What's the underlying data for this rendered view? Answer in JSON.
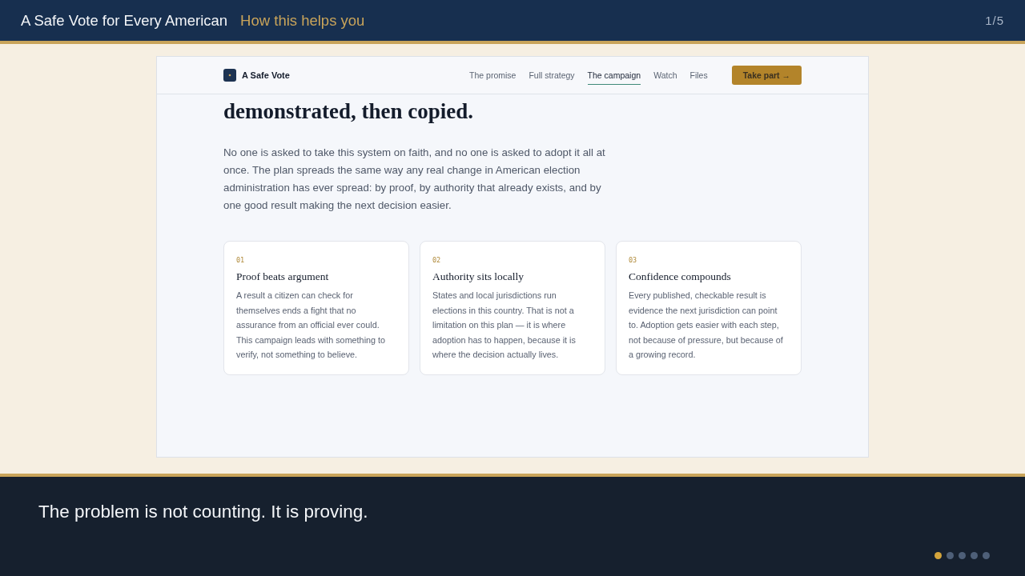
{
  "header": {
    "title": "A Safe Vote for Every American",
    "subtitle": "How this helps you",
    "counter": "1/5"
  },
  "embedded_page": {
    "nav": {
      "brand": "A Safe Vote",
      "links": [
        {
          "label": "The promise",
          "selected": false
        },
        {
          "label": "Full strategy",
          "selected": false
        },
        {
          "label": "The campaign",
          "selected": true
        },
        {
          "label": "Watch",
          "selected": false
        },
        {
          "label": "Files",
          "selected": false
        }
      ],
      "cta": "Take part →"
    },
    "headline": "demonstrated, then copied.",
    "intro": "No one is asked to take this system on faith, and no one is asked to adopt it all at once. The plan spreads the same way any real change in American election administration has ever spread: by proof, by authority that already exists, and by one good result making the next decision easier.",
    "cards": [
      {
        "number": "01",
        "title": "Proof beats argument",
        "body": "A result a citizen can check for themselves ends a fight that no assurance from an official ever could. This campaign leads with something to verify, not something to believe."
      },
      {
        "number": "02",
        "title": "Authority sits locally",
        "body": "States and local jurisdictions run elections in this country. That is not a limitation on this plan — it is where adoption has to happen, because it is where the decision actually lives."
      },
      {
        "number": "03",
        "title": "Confidence compounds",
        "body": "Every published, checkable result is evidence the next jurisdiction can point to. Adoption gets easier with each step, not because of pressure, but because of a growing record."
      }
    ]
  },
  "caption": "The problem is not counting. It is proving.",
  "progress_dots": [
    {
      "selected": true
    },
    {
      "selected": false
    },
    {
      "selected": false
    },
    {
      "selected": false
    },
    {
      "selected": false
    }
  ]
}
